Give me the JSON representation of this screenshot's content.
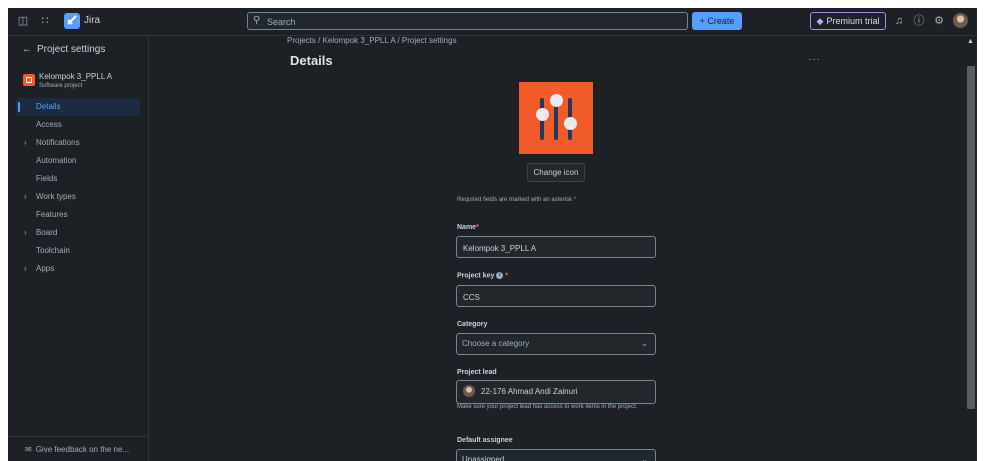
{
  "topbar": {
    "sidebar_toggle_icon": "sidebar-toggle-icon",
    "app_switcher_icon": "app-grid-icon",
    "app_name": "Jira",
    "search_placeholder": "Search",
    "create_label": "Create",
    "premium_label": "Premium trial",
    "notifications_icon": "bell-icon",
    "help_icon": "question-icon",
    "settings_icon": "gear-icon"
  },
  "sidebar": {
    "back_label": "Project settings",
    "project_name": "Kelompok 3_PPLL A",
    "project_type": "Software project",
    "items": [
      {
        "label": "Details",
        "expandable": false,
        "active": true
      },
      {
        "label": "Access",
        "expandable": false,
        "active": false
      },
      {
        "label": "Notifications",
        "expandable": true,
        "active": false
      },
      {
        "label": "Automation",
        "expandable": false,
        "active": false
      },
      {
        "label": "Fields",
        "expandable": false,
        "active": false
      },
      {
        "label": "Work types",
        "expandable": true,
        "active": false
      },
      {
        "label": "Features",
        "expandable": false,
        "active": false
      },
      {
        "label": "Board",
        "expandable": true,
        "active": false
      },
      {
        "label": "Toolchain",
        "expandable": false,
        "active": false
      },
      {
        "label": "Apps",
        "expandable": true,
        "active": false
      }
    ],
    "feedback_label": "Give feedback on the ne..."
  },
  "main": {
    "breadcrumb": "Projects  /  Kelompok 3_PPLL A  /  Project settings",
    "title": "Details",
    "more_label": "···",
    "change_icon_label": "Change icon",
    "required_note": "Required fields are marked with an asterisk",
    "asterisk": "*",
    "name_label": "Name",
    "name_value": "Kelompok 3_PPLL A",
    "project_key_label": "Project key",
    "project_key_value": "CCS",
    "category_label": "Category",
    "category_placeholder": "Choose a category",
    "project_lead_label": "Project lead",
    "project_lead_value": "22-176 Ahmad Andi Zainuri",
    "project_lead_help": "Make sure your project lead has access to work items in the project.",
    "default_assignee_label": "Default assignee",
    "default_assignee_value": "Unassigned"
  },
  "colors": {
    "background": "#1d2125",
    "accent": "#579dff",
    "project_icon": "#f15b2a",
    "premium": "#9f8fef",
    "required": "#f87168"
  }
}
